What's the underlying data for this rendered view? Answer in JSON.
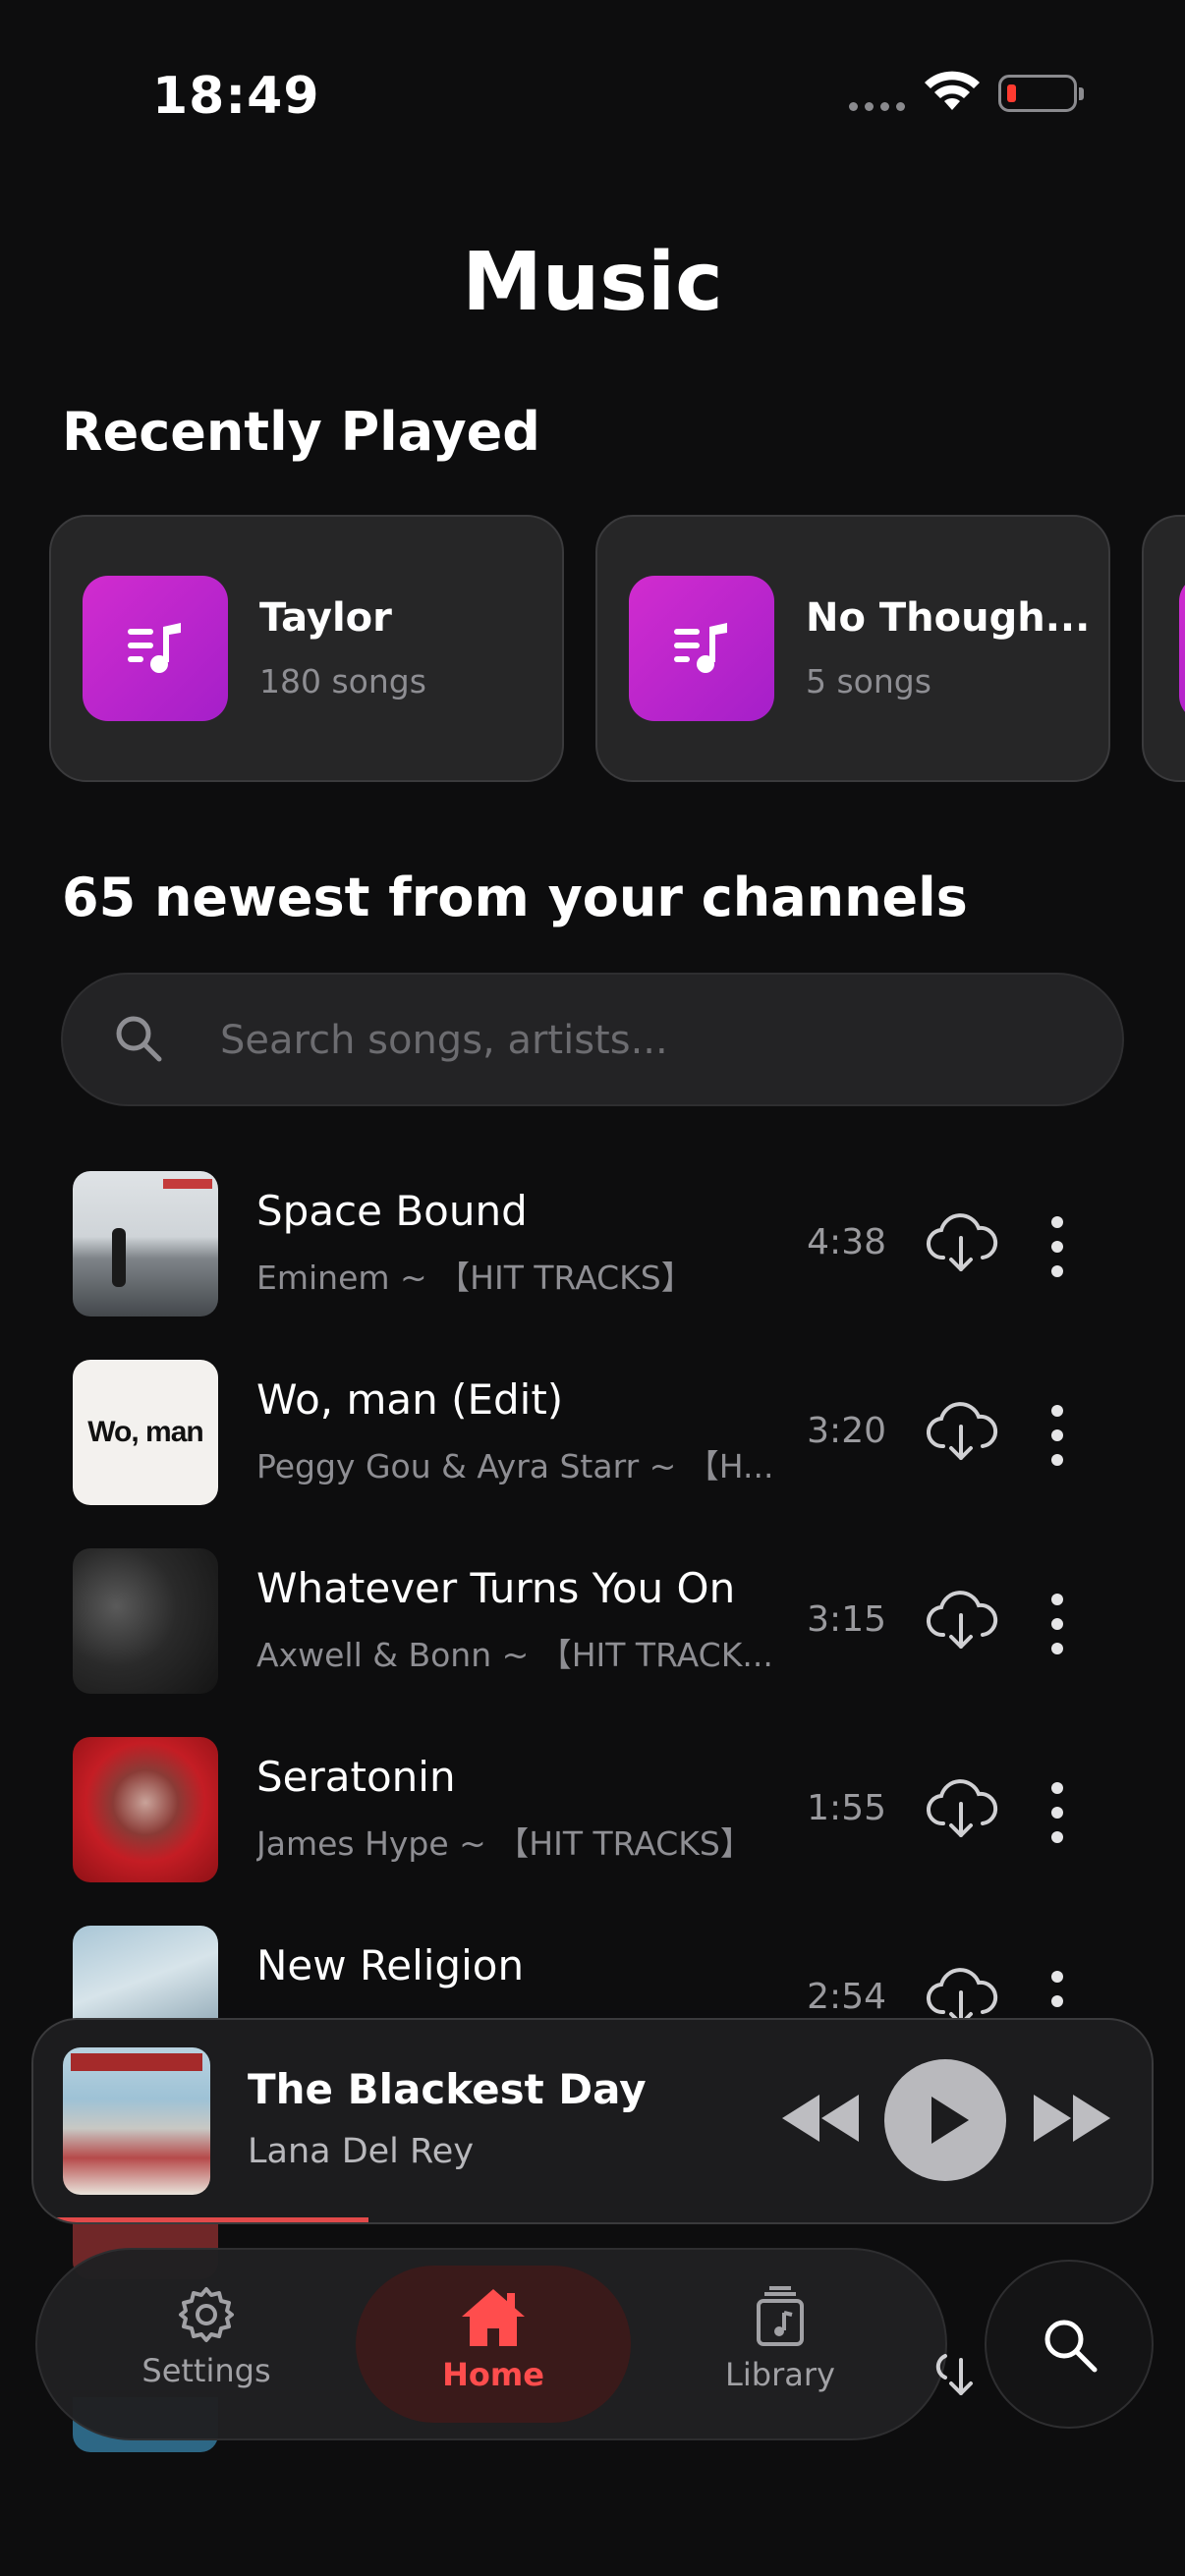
{
  "status": {
    "time": "18:49"
  },
  "page": {
    "title": "Music"
  },
  "recently_played": {
    "heading": "Recently Played",
    "cards": [
      {
        "name": "Taylor",
        "count": "180 songs"
      },
      {
        "name": "No Though...",
        "count": "5 songs"
      }
    ]
  },
  "channels": {
    "heading": "65 newest from your channels"
  },
  "search": {
    "placeholder": "Search songs, artists..."
  },
  "songs": [
    {
      "title": "Space Bound",
      "subtitle": "Eminem ~ 【HIT TRACKS】",
      "duration": "4:38"
    },
    {
      "title": "Wo, man (Edit)",
      "subtitle": "Peggy Gou & Ayra Starr ~ 【H...",
      "duration": "3:20",
      "art_text": "Wo, man"
    },
    {
      "title": "Whatever Turns You On",
      "subtitle": "Axwell & Bonn ~ 【HIT TRACK...",
      "duration": "3:15"
    },
    {
      "title": "Seratonin",
      "subtitle": "James Hype ~ 【HIT TRACKS】",
      "duration": "1:55"
    },
    {
      "title": "New Religion",
      "subtitle": "",
      "duration": "2:54"
    }
  ],
  "player": {
    "title": "The Blackest Day",
    "artist": "Lana Del Rey",
    "progress": 0.3
  },
  "tabs": [
    {
      "label": "Settings",
      "icon": "gear-icon"
    },
    {
      "label": "Home",
      "icon": "home-icon",
      "active": true
    },
    {
      "label": "Library",
      "icon": "library-icon"
    }
  ],
  "colors": {
    "accent": "#ff4d4d",
    "playlist_gradient": "#d12ccf",
    "background": "#0d0d0e"
  }
}
